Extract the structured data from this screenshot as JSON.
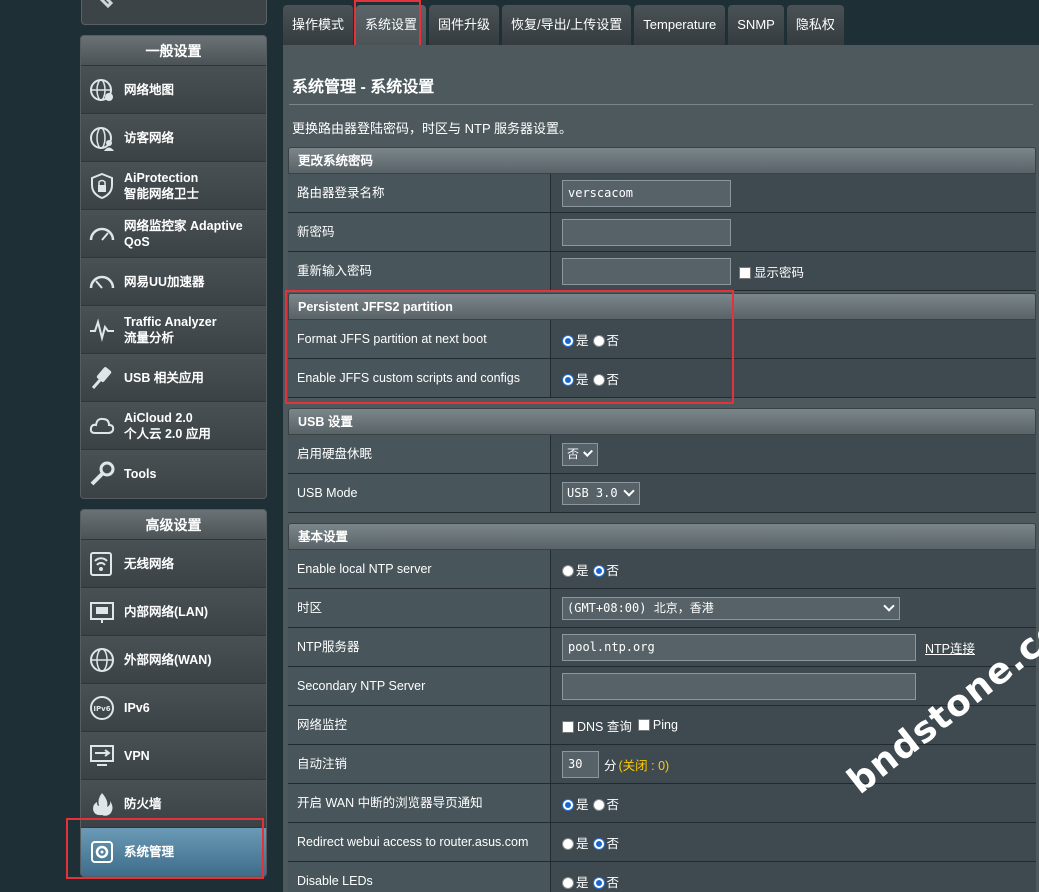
{
  "sidebar": {
    "general_header": "一般设置",
    "general_items": [
      {
        "label": "网络地图",
        "icon": "globe-network-icon"
      },
      {
        "label": "访客网络",
        "icon": "guest-network-icon"
      },
      {
        "label": "AiProtection\n智能网络卫士",
        "icon": "shield-lock-icon"
      },
      {
        "label": "网络监控家 Adaptive\nQoS",
        "icon": "speedometer-icon"
      },
      {
        "label": "网易UU加速器",
        "icon": "accelerator-icon"
      },
      {
        "label": "Traffic Analyzer\n流量分析",
        "icon": "traffic-pulse-icon"
      },
      {
        "label": "USB 相关应用",
        "icon": "usb-icon"
      },
      {
        "label": "AiCloud 2.0\n个人云 2.0 应用",
        "icon": "cloud-icon"
      },
      {
        "label": "Tools",
        "icon": "wrench-icon"
      }
    ],
    "advanced_header": "高级设置",
    "advanced_items": [
      {
        "label": "无线网络",
        "icon": "wireless-icon"
      },
      {
        "label": "内部网络(LAN)",
        "icon": "lan-icon"
      },
      {
        "label": "外部网络(WAN)",
        "icon": "wan-globe-icon"
      },
      {
        "label": "IPv6",
        "icon": "ipv6-icon"
      },
      {
        "label": "VPN",
        "icon": "vpn-icon"
      },
      {
        "label": "防火墙",
        "icon": "firewall-icon"
      },
      {
        "label": "系统管理",
        "icon": "admin-gear-icon"
      }
    ]
  },
  "tabs": [
    "操作模式",
    "系统设置",
    "固件升级",
    "恢复/导出/上传设置",
    "Temperature",
    "SNMP",
    "隐私权"
  ],
  "active_tab": "系统设置",
  "page": {
    "title": "系统管理 - 系统设置",
    "description": "更换路由器登陆密码，时区与 NTP 服务器设置。"
  },
  "password_section": {
    "header": "更改系统密码",
    "login_name_label": "路由器登录名称",
    "login_name_value": "verscacom",
    "new_password_label": "新密码",
    "retype_password_label": "重新输入密码",
    "show_password_label": "显示密码"
  },
  "jffs_section": {
    "header": "Persistent JFFS2 partition",
    "format_label": "Format JFFS partition at next boot",
    "scripts_label": "Enable JFFS custom scripts and configs"
  },
  "usb_section": {
    "header": "USB 设置",
    "hdd_sleep_label": "启用硬盘休眠",
    "hdd_sleep_value": "否",
    "usb_mode_label": "USB Mode",
    "usb_mode_value": "USB 3.0"
  },
  "basic_section": {
    "header": "基本设置",
    "local_ntp_label": "Enable local NTP server",
    "timezone_label": "时区",
    "timezone_value": "(GMT+08:00) 北京，香港",
    "ntp_server_label": "NTP服务器",
    "ntp_server_value": "pool.ntp.org",
    "ntp_link": "NTP连接",
    "secondary_ntp_label": "Secondary NTP Server",
    "net_monitor_label": "网络监控",
    "dns_query_label": "DNS 查询",
    "ping_label": "Ping",
    "auto_logout_label": "自动注销",
    "auto_logout_value": "30",
    "auto_logout_unit": "分",
    "auto_logout_hint": "(关闭 : 0)",
    "wan_notify_label": "开启 WAN 中断的浏览器导页通知",
    "redirect_label": "Redirect webui access to router.asus.com",
    "leds_label": "Disable LEDs"
  },
  "options": {
    "yes": "是",
    "no": "否"
  },
  "watermark": "bndstone.com"
}
